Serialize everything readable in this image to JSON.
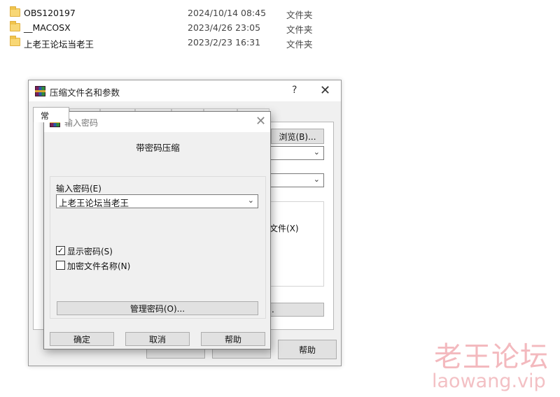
{
  "explorer": {
    "files": [
      {
        "name": "OBS120197",
        "date": "2024/10/14 08:45",
        "type": "文件夹"
      },
      {
        "name": "__MACOSX",
        "date": "2023/4/26 23:05",
        "type": "文件夹"
      },
      {
        "name": "上老王论坛当老王",
        "date": "2023/2/23 16:31",
        "type": "文件夹"
      }
    ]
  },
  "archive_dialog": {
    "title": "压缩文件名和参数",
    "help_glyph": "?",
    "close_glyph": "✕",
    "active_tab_fragment": "常",
    "browse_label": "浏览(B)...",
    "file_option_fragment": "文件(X)",
    "button2_fragment": ".",
    "help_label": "帮助"
  },
  "password_dialog": {
    "title": "输入密码",
    "close_glyph": "✕",
    "heading": "带密码压缩",
    "input_label": "输入密码(E)",
    "password_value": "上老王论坛当老王",
    "show_password_label": "显示密码(S)",
    "show_password_checked": true,
    "encrypt_names_label": "加密文件名称(N)",
    "encrypt_names_checked": false,
    "manage_label": "管理密码(O)...",
    "ok_label": "确定",
    "cancel_label": "取消",
    "help_label": "帮助"
  },
  "icons": {
    "folder": "folder-icon",
    "app": "winrar-icon",
    "dropdown": "chevron-down-icon",
    "check_mark": "✓",
    "chevron_glyph": "⌄"
  },
  "watermark": {
    "chinese": "老王论坛",
    "site": "laowang.vip"
  },
  "colors": {
    "folder": "#f8d775",
    "dialog_bg": "#f0f0f0",
    "button": "#e1e1e1",
    "watermark": "#f3b9be"
  }
}
